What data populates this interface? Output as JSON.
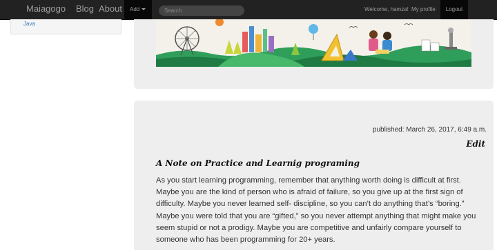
{
  "navbar": {
    "brand": "Maiagogo",
    "blog": "Blog",
    "about": "About",
    "add": "Add",
    "search_placeholder": "Search",
    "welcome": "Welcome, hamza!",
    "profile": "My profile",
    "logout": "Logout"
  },
  "sidebar": {
    "items": [
      {
        "label": "Java"
      }
    ]
  },
  "colors": {
    "navbar_bg": "#222222",
    "panel_bg": "#eeeeee",
    "link": "#337ab7"
  },
  "post": {
    "published": "published: March 26, 2017, 6:49 a.m.",
    "edit": "Edit",
    "title": "A Note on Practice and Learnig programing",
    "body": "As you start learning programming, remember that anything worth doing is difficult at first. Maybe you are the kind of person who is afraid of failure, so you give up at the first sign of difficulty. Maybe you never learned self- discipline, so you can’t do anything that’s “boring.” Maybe you were told that you are “gifted,” so you never attempt anything that might make you seem stupid or not a prodigy. Maybe you are competitive and unfairly compare yourself to someone who has been programming for 20+ years."
  }
}
